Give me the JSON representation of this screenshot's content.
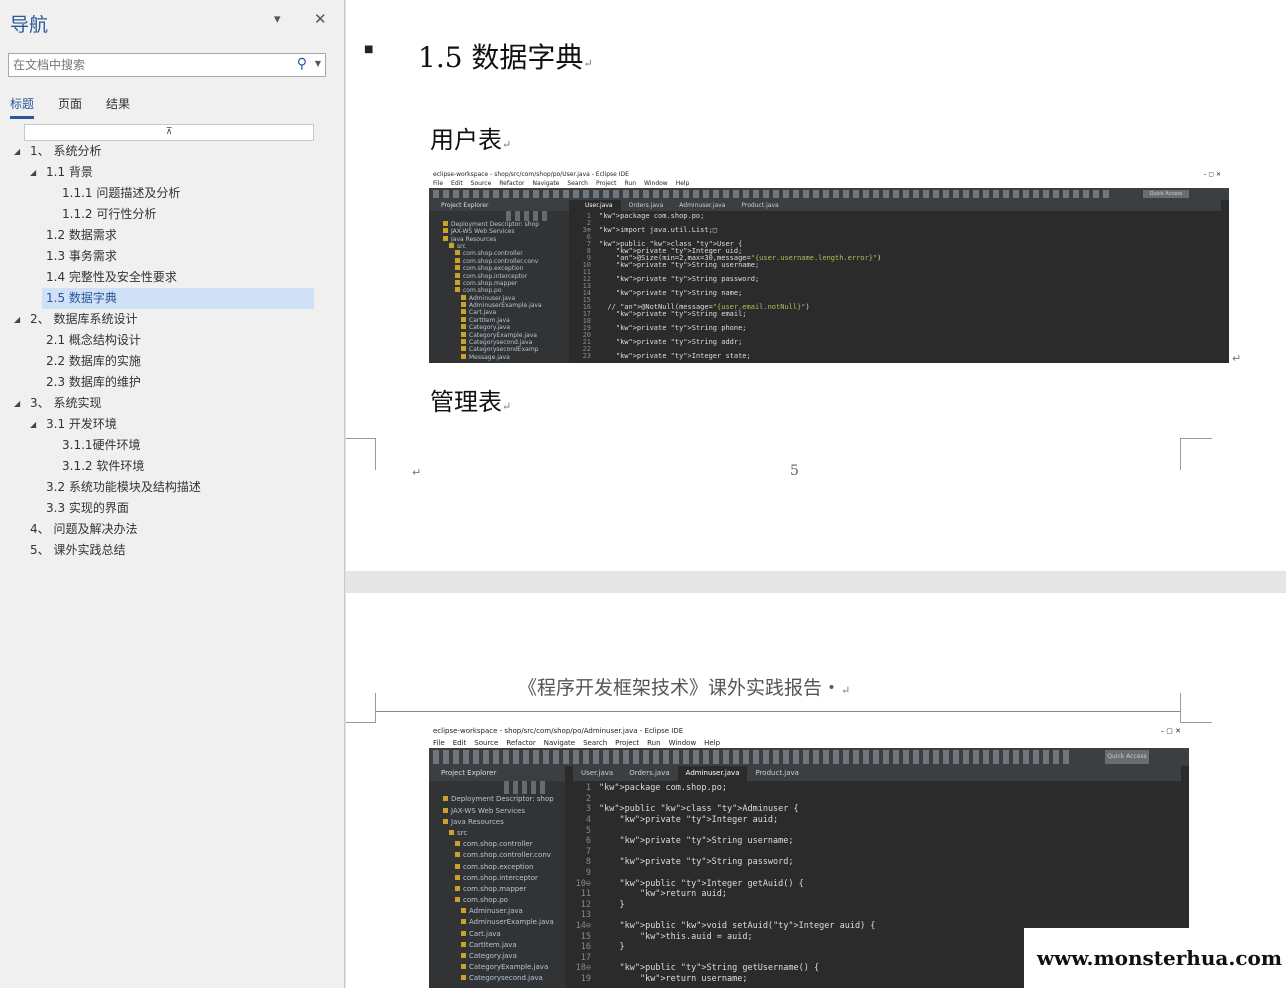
{
  "nav": {
    "title": "导航",
    "search_placeholder": "在文档中搜索",
    "tabs": [
      "标题",
      "页面",
      "结果"
    ],
    "items": [
      {
        "label": "1、 系统分析",
        "level": 0,
        "toggle": "◢"
      },
      {
        "label": "1.1 背景",
        "level": 1,
        "toggle": "◢"
      },
      {
        "label": "1.1.1 问题描述及分析",
        "level": 2,
        "toggle": ""
      },
      {
        "label": "1.1.2 可行性分析",
        "level": 2,
        "toggle": ""
      },
      {
        "label": "1.2 数据需求",
        "level": 1,
        "toggle": ""
      },
      {
        "label": "1.3 事务需求",
        "level": 1,
        "toggle": ""
      },
      {
        "label": "1.4 完整性及安全性要求",
        "level": 1,
        "toggle": ""
      },
      {
        "label": "1.5 数据字典",
        "level": 1,
        "toggle": "",
        "selected": true
      },
      {
        "label": "2、 数据库系统设计",
        "level": 0,
        "toggle": "◢"
      },
      {
        "label": "2.1 概念结构设计",
        "level": 1,
        "toggle": ""
      },
      {
        "label": "2.2 数据库的实施",
        "level": 1,
        "toggle": ""
      },
      {
        "label": "2.3 数据库的维护",
        "level": 1,
        "toggle": ""
      },
      {
        "label": "3、 系统实现",
        "level": 0,
        "toggle": "◢"
      },
      {
        "label": "3.1 开发环境",
        "level": 1,
        "toggle": "◢"
      },
      {
        "label": "3.1.1硬件环境",
        "level": 2,
        "toggle": ""
      },
      {
        "label": "3.1.2 软件环境",
        "level": 2,
        "toggle": ""
      },
      {
        "label": "3.2 系统功能模块及结构描述",
        "level": 1,
        "toggle": ""
      },
      {
        "label": "3.3 实现的界面",
        "level": 1,
        "toggle": ""
      },
      {
        "label": "4、 问题及解决办法",
        "level": 0,
        "toggle": ""
      },
      {
        "label": "5、 课外实践总结",
        "level": 0,
        "toggle": ""
      }
    ]
  },
  "doc": {
    "heading": "1.5 数据字典",
    "para_mark": "↵",
    "user_table": "用户表",
    "admin_table": "管理表",
    "page_number": "5",
    "page2_header": "《程序开发框架技术》课外实践报告・",
    "watermark": "www.monsterhua.com"
  },
  "eclipse1": {
    "title": "eclipse-workspace - shop/src/com/shop/po/User.java - Eclipse IDE",
    "menu": [
      "File",
      "Edit",
      "Source",
      "Refactor",
      "Navigate",
      "Search",
      "Project",
      "Run",
      "Window",
      "Help"
    ],
    "quick_access": "Quick Access",
    "explorer_title": "Project Explorer",
    "explorer": [
      "Deployment Descriptor: shop",
      "JAX-WS Web Services",
      "Java Resources",
      "src",
      "com.shop.controller",
      "com.shop.controller.conv",
      "com.shop.exception",
      "com.shop.interceptor",
      "com.shop.mapper",
      "com.shop.po",
      "Adminuser.java",
      "AdminuserExample.java",
      "Cart.java",
      "CartItem.java",
      "Category.java",
      "CategoryExample.java",
      "Categorysecond.java",
      "CategorysecondExamp",
      "Message.java"
    ],
    "tabs": [
      "User.java",
      "Orders.java",
      "Adminuser.java",
      "Product.java"
    ],
    "line_numbers": [
      "1",
      "2",
      "3⊕",
      "6",
      "7",
      "8",
      "9",
      "10",
      "11",
      "12",
      "13",
      "14",
      "15",
      "16",
      "17",
      "18",
      "19",
      "20",
      "21",
      "22",
      "23"
    ],
    "code": [
      "package com.shop.po;",
      "",
      "import java.util.List;□",
      "",
      "public class User {",
      "    private Integer uid;",
      "    @Size(min=2,max=30,message=\"{user.username.length.error}\")",
      "    private String username;",
      "",
      "    private String password;",
      "",
      "    private String name;",
      "",
      "  // @NotNull(message=\"{user.email.notNull}\")",
      "    private String email;",
      "",
      "    private String phone;",
      "",
      "    private String addr;",
      "",
      "    private Integer state;"
    ]
  },
  "eclipse2": {
    "title": "eclipse-workspace - shop/src/com/shop/po/Adminuser.java - Eclipse IDE",
    "menu": [
      "File",
      "Edit",
      "Source",
      "Refactor",
      "Navigate",
      "Search",
      "Project",
      "Run",
      "Window",
      "Help"
    ],
    "quick_access": "Quick Access",
    "explorer_title": "Project Explorer",
    "explorer": [
      "Deployment Descriptor: shop",
      "JAX-WS Web Services",
      "Java Resources",
      "src",
      "com.shop.controller",
      "com.shop.controller.conv",
      "com.shop.exception",
      "com.shop.interceptor",
      "com.shop.mapper",
      "com.shop.po",
      "Adminuser.java",
      "AdminuserExample.java",
      "Cart.java",
      "CartItem.java",
      "Category.java",
      "CategoryExample.java",
      "Categorysecond.java"
    ],
    "tabs": [
      "User.java",
      "Orders.java",
      "Adminuser.java",
      "Product.java"
    ],
    "line_numbers": [
      "1",
      "2",
      "3",
      "4",
      "5",
      "6",
      "7",
      "8",
      "9",
      "10⊖",
      "11",
      "12",
      "13",
      "14⊖",
      "15",
      "16",
      "17",
      "18⊖",
      "19"
    ],
    "code": [
      "package com.shop.po;",
      "",
      "public class Adminuser {",
      "    private Integer auid;",
      "",
      "    private String username;",
      "",
      "    private String password;",
      "",
      "    public Integer getAuid() {",
      "        return auid;",
      "    }",
      "",
      "    public void setAuid(Integer auid) {",
      "        this.auid = auid;",
      "    }",
      "",
      "    public String getUsername() {",
      "        return username;"
    ]
  }
}
